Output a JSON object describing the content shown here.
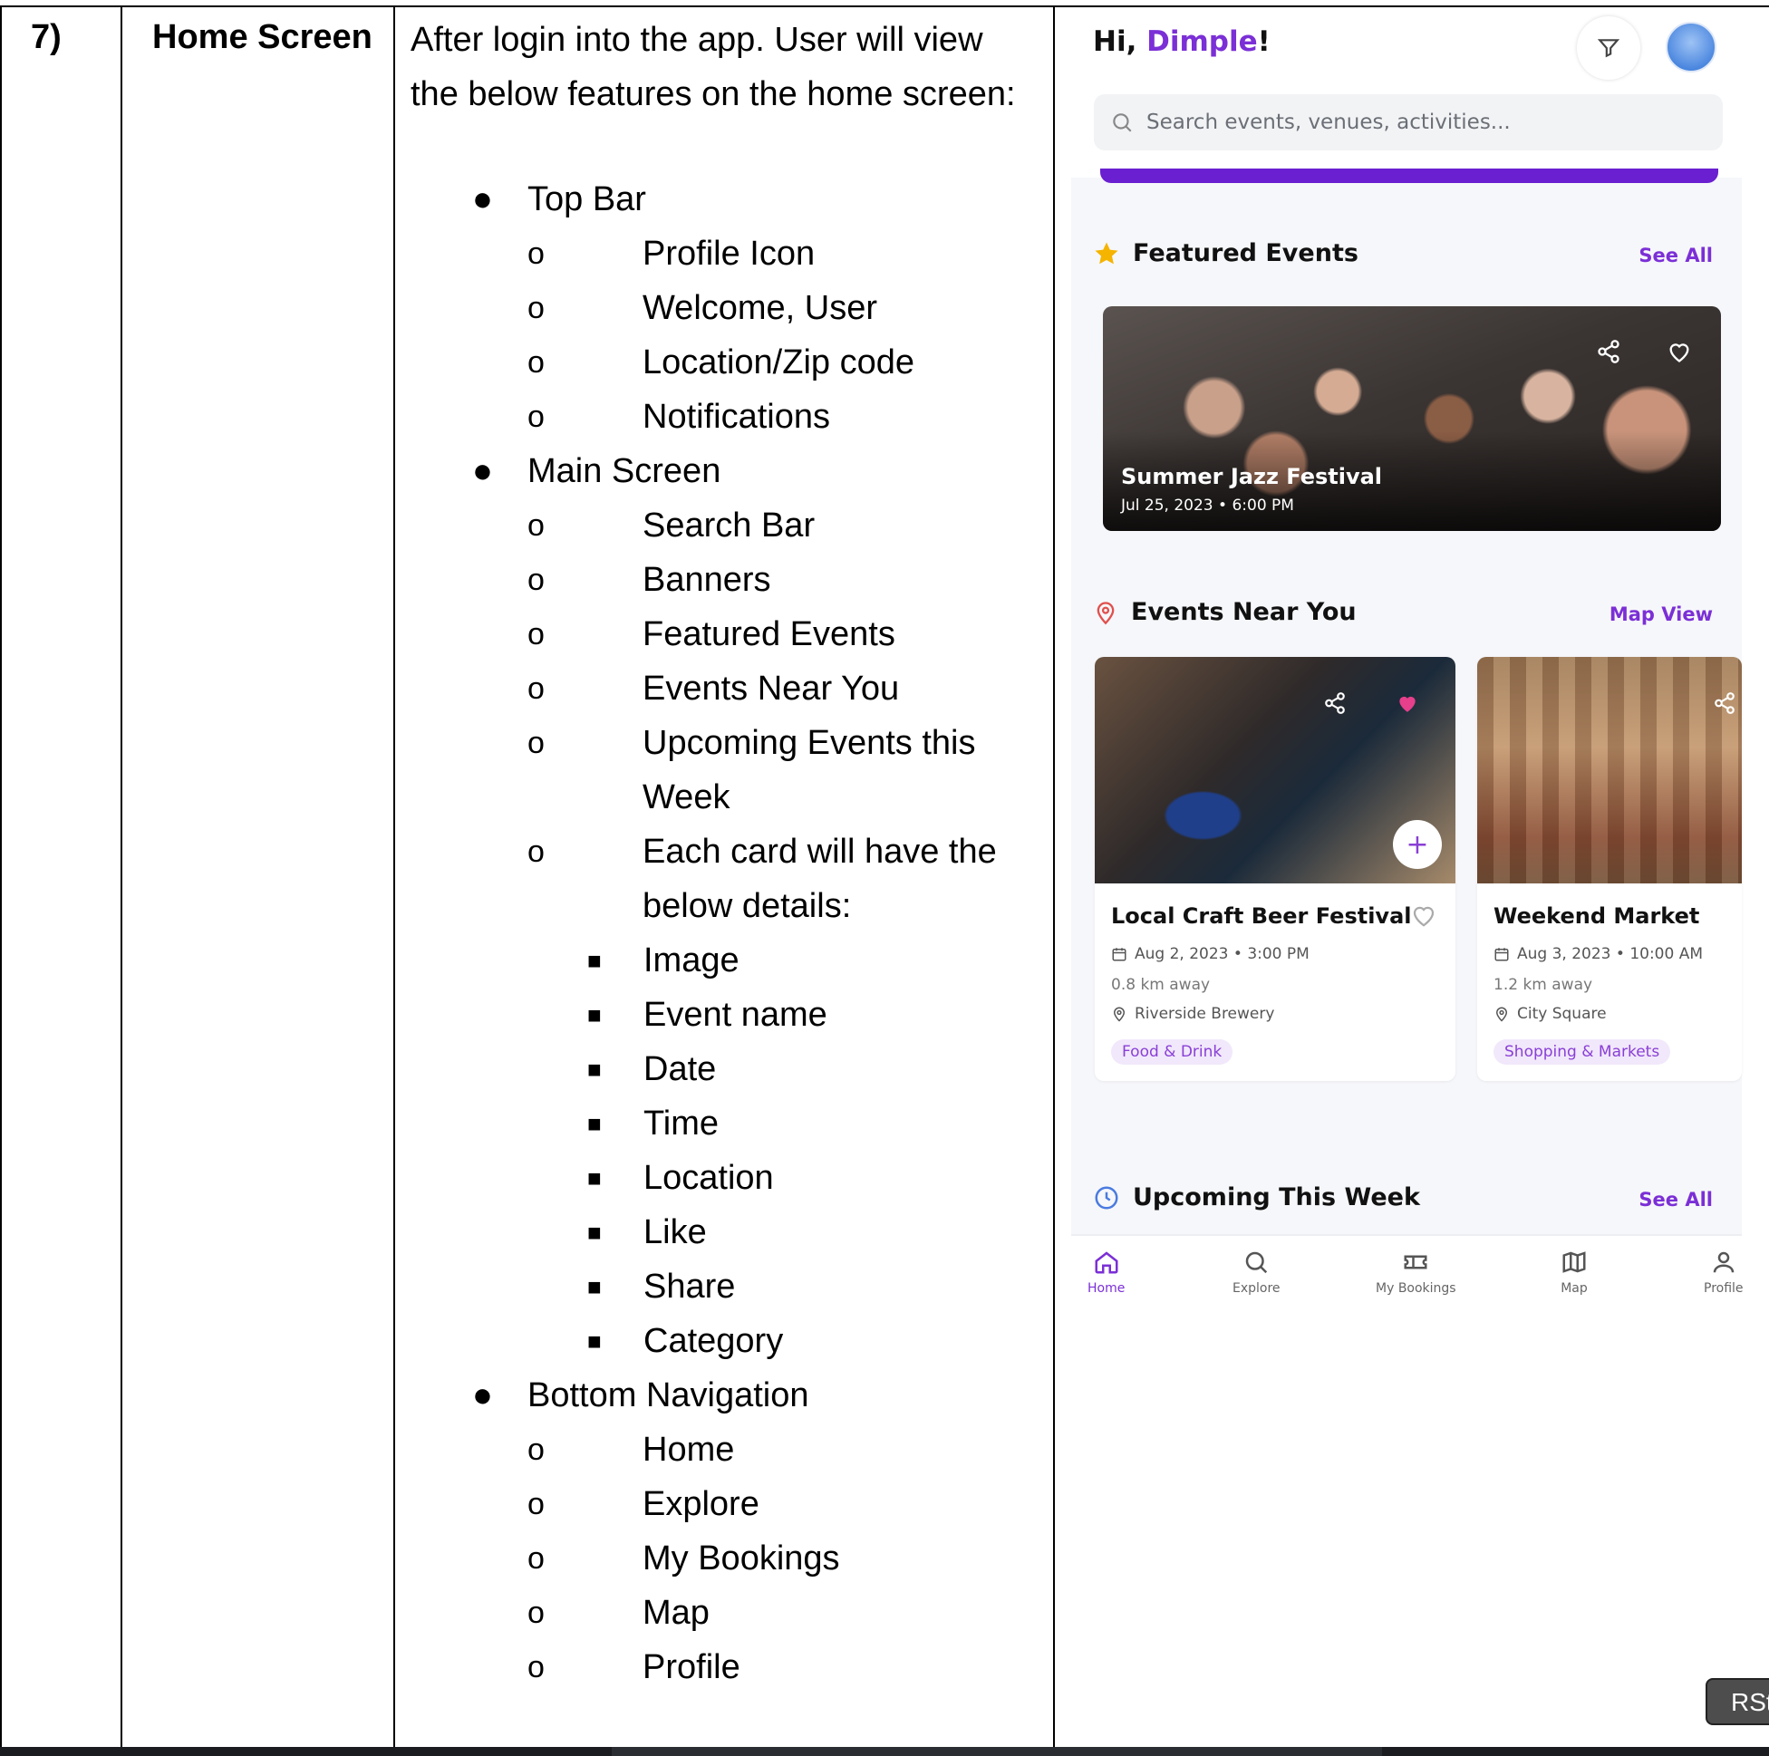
{
  "row": {
    "number": "7)",
    "title": "Home Screen",
    "intro": "After login into the app. User will view the below features on the home screen:",
    "features": [
      {
        "label": "Top Bar",
        "items": [
          {
            "label": "Profile Icon"
          },
          {
            "label": "Welcome, User"
          },
          {
            "label": "Location/Zip code"
          },
          {
            "label": "Notifications"
          }
        ]
      },
      {
        "label": "Main Screen",
        "items": [
          {
            "label": "Search Bar"
          },
          {
            "label": "Banners"
          },
          {
            "label": "Featured Events"
          },
          {
            "label": "Events Near You"
          },
          {
            "label": "Upcoming Events this Week"
          },
          {
            "label": "Each card will have the below details:",
            "sub": [
              "Image",
              "Event name",
              "Date",
              "Time",
              "Location",
              "Like",
              "Share",
              "Category"
            ]
          }
        ]
      },
      {
        "label": "Bottom Navigation",
        "items": [
          {
            "label": "Home"
          },
          {
            "label": "Explore"
          },
          {
            "label": "My Bookings"
          },
          {
            "label": "Map"
          },
          {
            "label": "Profile"
          }
        ]
      }
    ]
  },
  "app": {
    "greeting_prefix": "Hi, ",
    "user_name": "Dimple",
    "greeting_suffix": "!",
    "search_placeholder": "Search events, venues, activities...",
    "accent_color": "#7b2fd6",
    "featured": {
      "heading": "Featured Events",
      "link": "See All",
      "event": {
        "name": "Summer Jazz Festival",
        "datetime": "Jul 25, 2023 • 6:00 PM"
      }
    },
    "near": {
      "heading": "Events Near You",
      "link": "Map View",
      "cards": [
        {
          "name": "Local Craft Beer Festival",
          "datetime": "Aug 2, 2023 • 3:00 PM",
          "distance": "0.8 km away",
          "venue": "Riverside Brewery",
          "category": "Food & Drink"
        },
        {
          "name": "Weekend Market",
          "datetime": "Aug 3, 2023 • 10:00 AM",
          "distance": "1.2 km away",
          "venue": "City Square",
          "category": "Shopping & Markets"
        }
      ]
    },
    "upcoming": {
      "heading": "Upcoming This Week",
      "link": "See All"
    },
    "nav": [
      "Home",
      "Explore",
      "My Bookings",
      "Map",
      "Profile"
    ]
  },
  "overlay_button": "RSt"
}
